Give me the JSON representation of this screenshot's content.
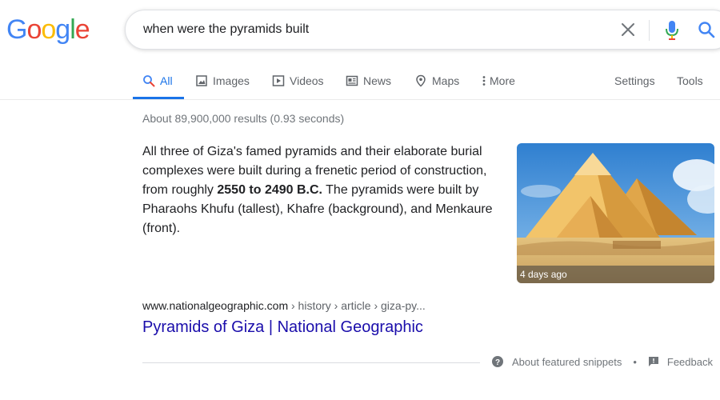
{
  "logo": {
    "letters": [
      {
        "ch": "G",
        "color": "#4285F4"
      },
      {
        "ch": "o",
        "color": "#EA4335"
      },
      {
        "ch": "o",
        "color": "#FBBC05"
      },
      {
        "ch": "g",
        "color": "#4285F4"
      },
      {
        "ch": "l",
        "color": "#34A853"
      },
      {
        "ch": "e",
        "color": "#EA4335"
      }
    ]
  },
  "search": {
    "query": "when were the pyramids built",
    "clear_icon": "close-icon",
    "mic_icon": "microphone-icon",
    "search_icon": "search-icon"
  },
  "tabs": {
    "items": [
      {
        "label": "All",
        "icon": "search-icon",
        "active": true
      },
      {
        "label": "Images",
        "icon": "image-icon"
      },
      {
        "label": "Videos",
        "icon": "video-icon"
      },
      {
        "label": "News",
        "icon": "news-icon"
      },
      {
        "label": "Maps",
        "icon": "map-pin-icon"
      },
      {
        "label": "More",
        "icon": "more-vertical-icon"
      }
    ],
    "settings": "Settings",
    "tools": "Tools"
  },
  "results": {
    "stats": "About 89,900,000 results (0.93 seconds)"
  },
  "snippet": {
    "before": "All three of Giza's famed pyramids and their elaborate burial complexes were built during a frenetic period of construction, from roughly ",
    "bold": "2550 to 2490 B.C.",
    "after": " The pyramids were built by Pharaohs Khufu (tallest), Khafre (background), and Menkaure (front).",
    "image_caption": "4 days ago",
    "cite_domain": "www.nationalgeographic.com",
    "cite_path": " › history › article › giza-py...",
    "title": "Pyramids of Giza | National Geographic"
  },
  "footer": {
    "about": "About featured snippets",
    "separator": "•",
    "feedback": "Feedback"
  },
  "colors": {
    "accent": "#1a73e8",
    "link": "#1a0dab",
    "muted": "#70757a"
  }
}
